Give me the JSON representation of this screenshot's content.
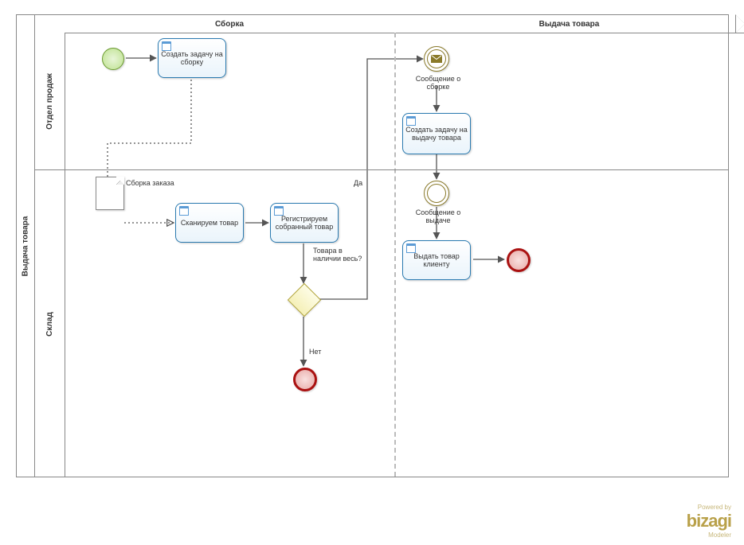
{
  "pool": {
    "title": "Выдача товара"
  },
  "lanes": {
    "l1": "Отдел продаж",
    "l2": "Склад"
  },
  "phases": {
    "p1": "Сборка",
    "p2": "Выдача товара"
  },
  "tasks": {
    "create_assembly": "Создать задачу на сборку",
    "scan": "Сканируем товар",
    "register": "Регистрируем собранный товар",
    "create_issue": "Создать задачу на выдачу товара",
    "issue_client": "Выдать товар клиенту"
  },
  "events": {
    "msg_assembly": "Сообщение о сборке",
    "msg_issue": "Сообщение о выдаче"
  },
  "artifacts": {
    "order": "Сборка заказа"
  },
  "gateway": {
    "q": "Товара в наличии весь?",
    "yes": "Да",
    "no": "Нет"
  },
  "branding": {
    "powered": "Powered by",
    "name": "bizagi",
    "sub": "Modeler"
  }
}
